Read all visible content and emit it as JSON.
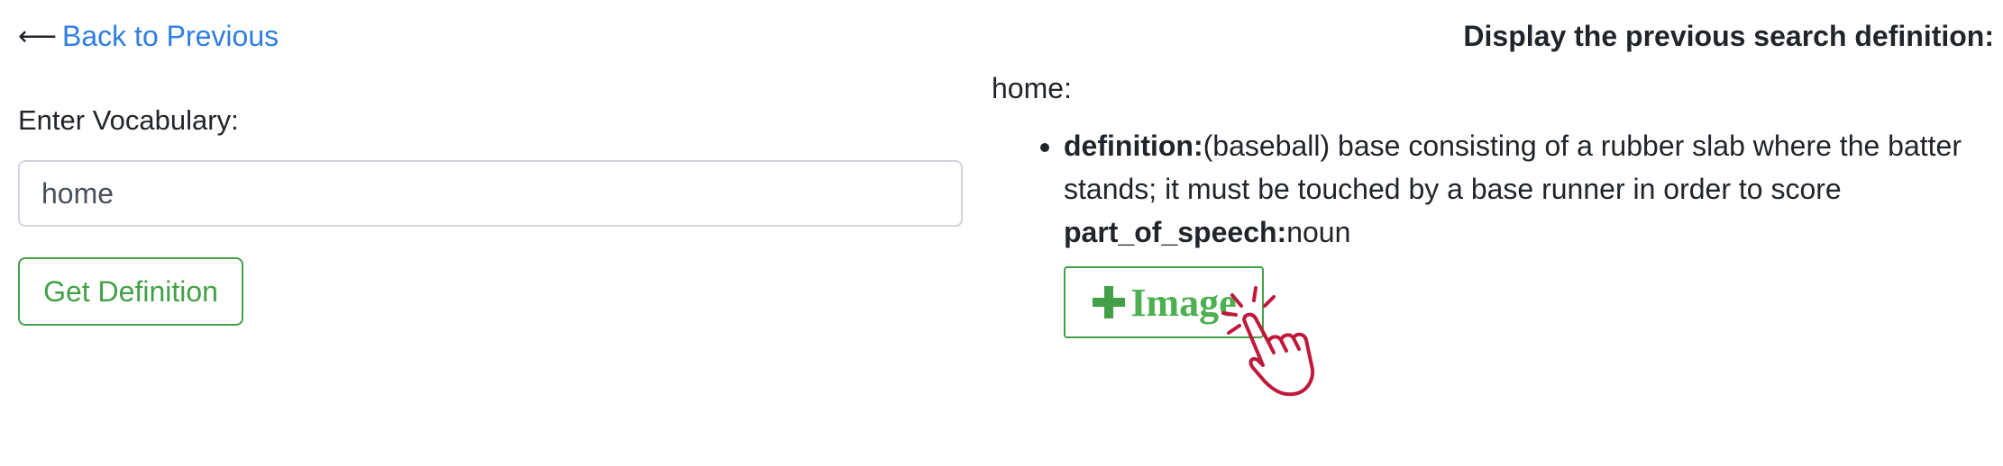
{
  "nav": {
    "back_label": "Back to Previous",
    "back_icon": "left-arrow-icon"
  },
  "search": {
    "label": "Enter Vocabulary:",
    "input_value": "home",
    "button_label": "Get Definition"
  },
  "result": {
    "title": "Display the previous search definition:",
    "word": "home:",
    "definition_key": "definition:",
    "definition_text": "(baseball) base consisting of a rubber slab where the batter stands; it must be touched by a base runner in order to score",
    "pos_key": "part_of_speech:",
    "pos_text": "noun",
    "image_button_label": "Image",
    "image_button_icon": "plus-icon",
    "cursor_icon": "pointing-hand-click-icon"
  },
  "colors": {
    "link": "#2f7ee0",
    "success": "#43a047",
    "cursor": "#c0183a",
    "text": "#212529"
  }
}
